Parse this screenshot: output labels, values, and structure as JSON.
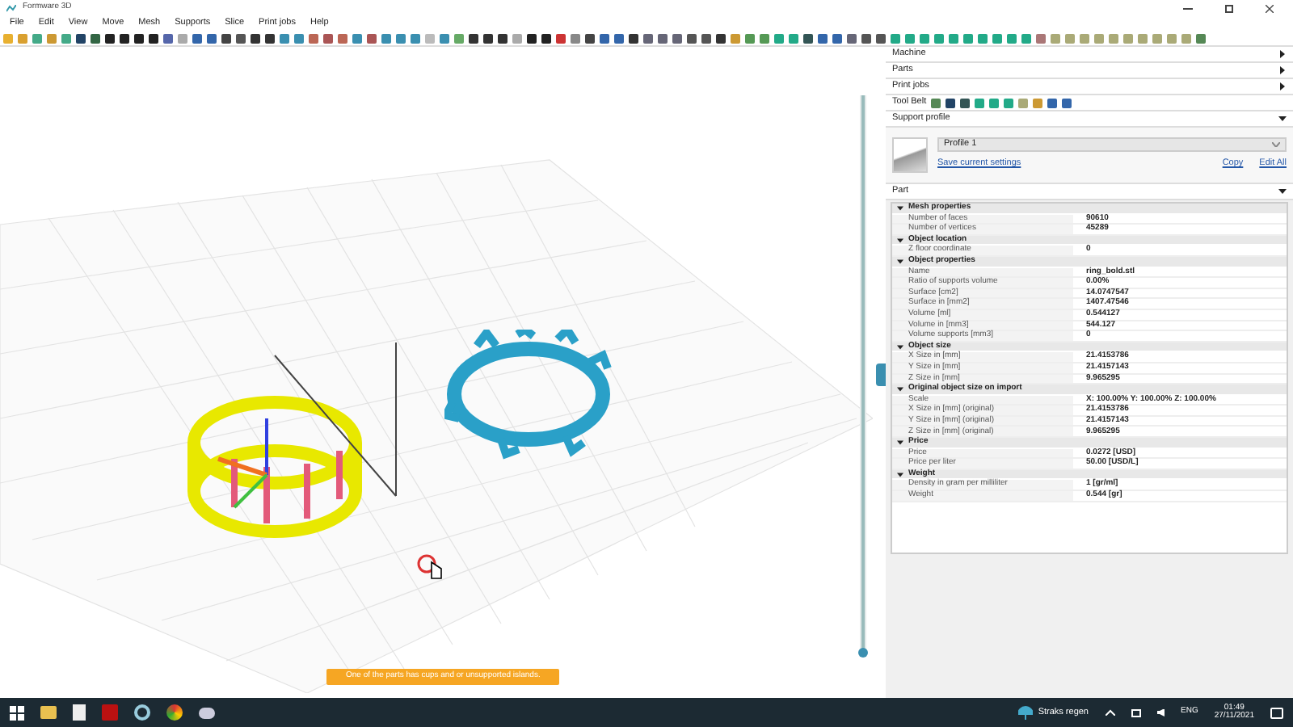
{
  "window": {
    "title": "Formware 3D"
  },
  "menu": [
    "File",
    "Edit",
    "View",
    "Move",
    "Mesh",
    "Supports",
    "Slice",
    "Print jobs",
    "Help"
  ],
  "viewport": {
    "warning": "One of the parts has cups and or unsupported islands.",
    "layer_slider": {
      "level": 1
    }
  },
  "panel": {
    "sections": [
      {
        "label": "Machine",
        "expanded": false
      },
      {
        "label": "Parts",
        "expanded": false
      },
      {
        "label": "Print jobs",
        "expanded": false
      }
    ],
    "tool_belt": {
      "label": "Tool Belt"
    },
    "support_profile": {
      "label": "Support profile",
      "expanded": true,
      "profile": "Profile 1",
      "save_link": "Save current settings",
      "copy_link": "Copy",
      "edit_link": "Edit All"
    },
    "part": {
      "label": "Part",
      "expanded": true,
      "groups": [
        {
          "title": "Mesh properties",
          "expanded": true,
          "rows": [
            {
              "name": "Number of faces",
              "value": "90610"
            },
            {
              "name": "Number of vertices",
              "value": "45289"
            }
          ]
        },
        {
          "title": "Object location",
          "expanded": true,
          "rows": [
            {
              "name": "Z floor coordinate",
              "value": "0"
            }
          ]
        },
        {
          "title": "Object properties",
          "expanded": true,
          "rows": [
            {
              "name": "Name",
              "value": "ring_bold.stl"
            },
            {
              "name": "Ratio of supports volume",
              "value": "0.00%"
            },
            {
              "name": "Surface [cm2]",
              "value": "14.0747547"
            },
            {
              "name": "Surface in [mm2]",
              "value": "1407.47546"
            },
            {
              "name": "Volume [ml]",
              "value": "0.544127"
            },
            {
              "name": "Volume in [mm3]",
              "value": "544.127"
            },
            {
              "name": "Volume supports [mm3]",
              "value": "0"
            }
          ]
        },
        {
          "title": "Object size",
          "expanded": true,
          "rows": [
            {
              "name": "X Size in [mm]",
              "value": "21.4153786"
            },
            {
              "name": "Y Size in [mm]",
              "value": "21.4157143"
            },
            {
              "name": "Z Size in [mm]",
              "value": "9.965295"
            }
          ]
        },
        {
          "title": "Original object size on import",
          "expanded": true,
          "rows": [
            {
              "name": "Scale",
              "value": "X: 100.00% Y: 100.00% Z: 100.00%"
            },
            {
              "name": "X Size in [mm] (original)",
              "value": "21.4153786"
            },
            {
              "name": "Y Size in [mm] (original)",
              "value": "21.4157143"
            },
            {
              "name": "Z Size in [mm] (original)",
              "value": "9.965295"
            }
          ]
        },
        {
          "title": "Price",
          "expanded": true,
          "rows": [
            {
              "name": "Price",
              "value": "0.0272 [USD]"
            },
            {
              "name": "Price per liter",
              "value": "50.00 [USD/L]"
            }
          ]
        },
        {
          "title": "Weight",
          "expanded": true,
          "rows": [
            {
              "name": "Density in gram per milliliter",
              "value": "1 [gr/ml]"
            },
            {
              "name": "Weight",
              "value": "0.544 [gr]"
            }
          ]
        }
      ]
    }
  },
  "taskbar": {
    "weather": "Straks regen",
    "language": "ENG",
    "time": "01:49",
    "date": "27/11/2021"
  }
}
